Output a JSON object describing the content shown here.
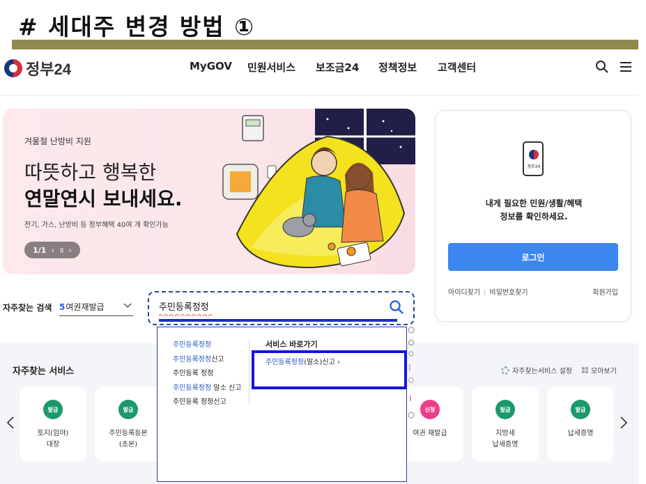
{
  "slide": {
    "title": "# 세대주 변경 방법 ①"
  },
  "header": {
    "logo_text": "정부24",
    "nav": [
      "MyGOV",
      "민원서비스",
      "보조금24",
      "정책정보",
      "고객센터"
    ]
  },
  "banner": {
    "subtitle": "겨울철 난방비 지원",
    "headline_1": "따뜻하고 행복한",
    "headline_2": "연말연시 보내세요.",
    "description": "전기, 가스, 난방비 등 정부혜택 40여 개 확인가능",
    "pager": {
      "current": "1/1",
      "prev": "‹",
      "pause": "॥",
      "next": "›"
    }
  },
  "login_card": {
    "phone_label": "정부24",
    "message_1": "내게 필요한 민원/생활/혜택",
    "message_2": "정보를 확인하세요.",
    "login_button": "로그인",
    "find_id": "아이디찾기",
    "sep": "|",
    "find_pw": "비밀번호찾기",
    "join": "회원가입"
  },
  "search": {
    "fav_label": "자주찾는 검색",
    "fav_select_num": "5",
    "fav_select_text": "여권재발급",
    "query": "주민등록정정"
  },
  "dropdown": {
    "suggestions": [
      {
        "hl": "주민등록정정",
        "rest": ""
      },
      {
        "hl": "주민등록정정",
        "rest": "신고"
      },
      {
        "hl": "",
        "rest": "주민등록 정정"
      },
      {
        "hl": "주민등록정정",
        "rest": " 말소 신고"
      },
      {
        "hl": "",
        "rest": "주민등록 정정신고"
      }
    ],
    "shortcut_title": "서비스 바로가기",
    "shortcut_hl": "주민등록정정",
    "shortcut_rest": "(말소)신고  ›"
  },
  "services": {
    "title": "자주찾는 서비스",
    "settings": "자주찾는서비스 설정",
    "view_all": "모아보기",
    "cards": [
      {
        "badge": "발급",
        "label_1": "토지(임야)",
        "label_2": "대장",
        "badge_color": "#1a9a6b"
      },
      {
        "badge": "발급",
        "label_1": "주민등록등본",
        "label_2": "(초본)",
        "badge_color": "#1a9a6b"
      },
      {
        "badge": "신청",
        "label_1": "여권 재발급",
        "label_2": "",
        "badge_color": "#ee3d8c"
      },
      {
        "badge": "발급",
        "label_1": "지방세",
        "label_2": "납세증명",
        "badge_color": "#1a9a6b"
      },
      {
        "badge": "발급",
        "label_1": "납세증명",
        "label_2": "",
        "badge_color": "#1a9a6b"
      }
    ]
  },
  "colors": {
    "primary_blue": "#3c87ef",
    "olive": "#8f8a4e",
    "highlight_blue": "#1414e0"
  }
}
